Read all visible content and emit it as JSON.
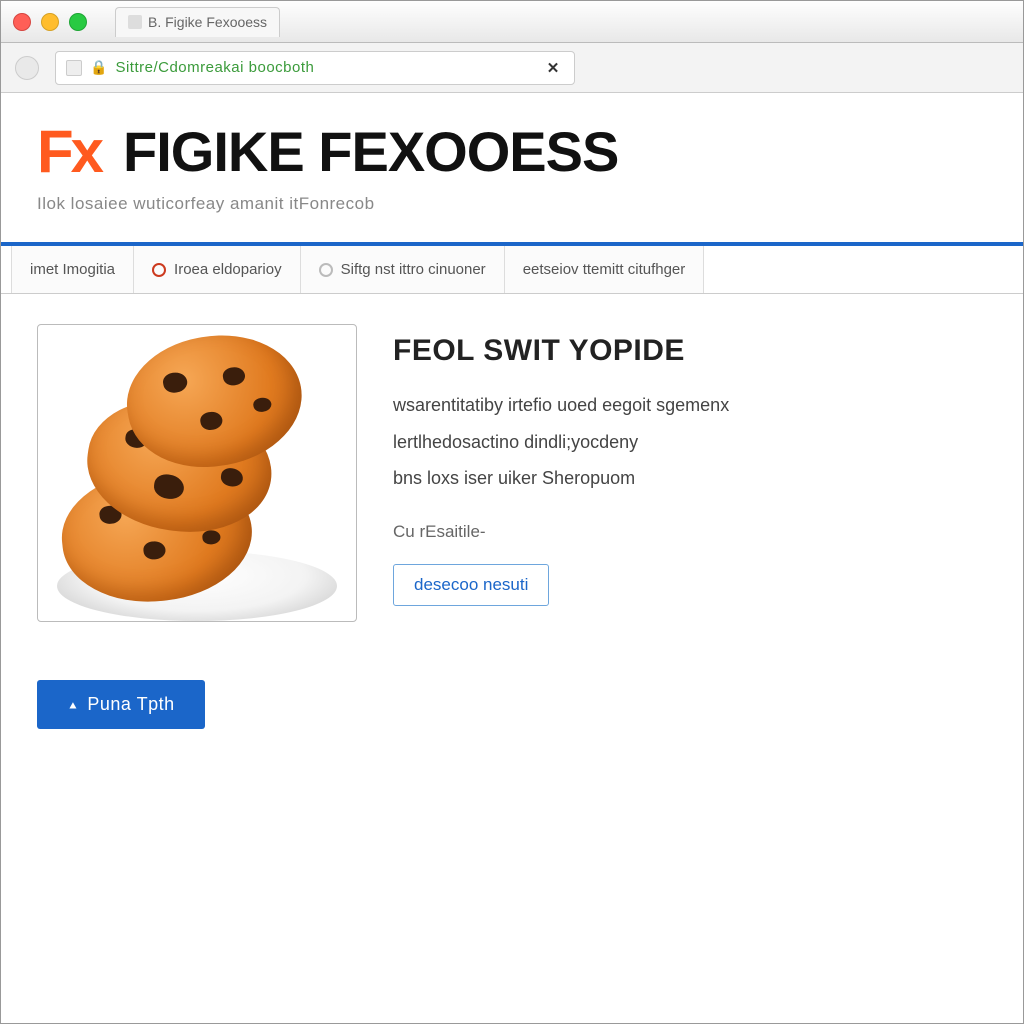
{
  "window": {
    "tab_title": "B. Figike Fexooess"
  },
  "urlbar": {
    "url_display": "Sittre/Cdomreakai boocboth"
  },
  "header": {
    "logo_mark": "Fx",
    "site_title": "Figike Fexooess",
    "tagline": "Ilok losaiee  wuticorfeay  amanit  itFonrecob"
  },
  "tabs": [
    {
      "label": "imet  Imogitia"
    },
    {
      "label": "Iroea eldoparioy"
    },
    {
      "label": "Siftg nst  ittro  cinuoner"
    },
    {
      "label": "eetseiov ttemitt  citufhger"
    }
  ],
  "product": {
    "title": "Feol swit yopide",
    "desc_line1": "wsarentitatiby irtefio uoed  eegoit sgemenx",
    "desc_line2": "lertlhedosactino  dindli;yocdeny",
    "desc_line3": "bns loxs  iser  uiker Sheropuom",
    "meta": "Cu rEsaitile-",
    "secondary_button": "desecoo nesuti",
    "primary_button": "Puna Tpth"
  }
}
